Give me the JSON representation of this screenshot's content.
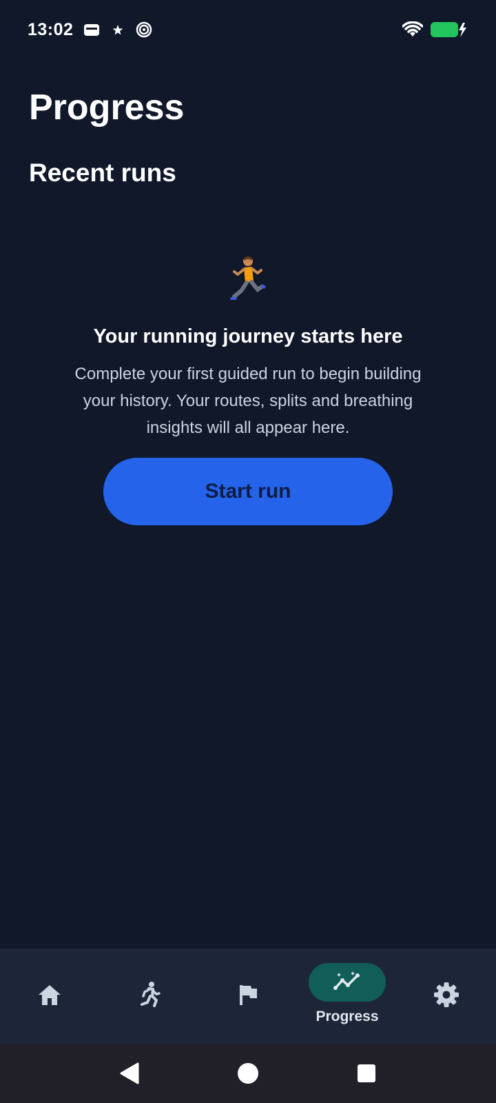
{
  "status_bar": {
    "time": "13:02",
    "left_icons": [
      "wallet-icon",
      "star-icon",
      "spiral-icon"
    ],
    "right_icons": [
      "wifi-icon",
      "battery-charging-icon"
    ],
    "battery_color": "#22c55e"
  },
  "header": {
    "title": "Progress"
  },
  "section": {
    "title": "Recent runs"
  },
  "empty_state": {
    "icon": "runner-icon",
    "heading": "Your running journey starts here",
    "body": "Complete your first guided run to begin building your history. Your routes, splits and breathing insights will all appear here.",
    "button_label": "Start run",
    "button_color": "#2563eb"
  },
  "bottom_nav": {
    "items": [
      {
        "icon": "home-icon",
        "label": ""
      },
      {
        "icon": "run-icon",
        "label": ""
      },
      {
        "icon": "flag-icon",
        "label": ""
      },
      {
        "icon": "progress-chart-icon",
        "label": "Progress",
        "active": true
      },
      {
        "icon": "gear-icon",
        "label": ""
      }
    ],
    "active_color": "#115e59"
  },
  "system_nav": {
    "icons": [
      "back-icon",
      "home-circle-icon",
      "recents-icon"
    ]
  }
}
